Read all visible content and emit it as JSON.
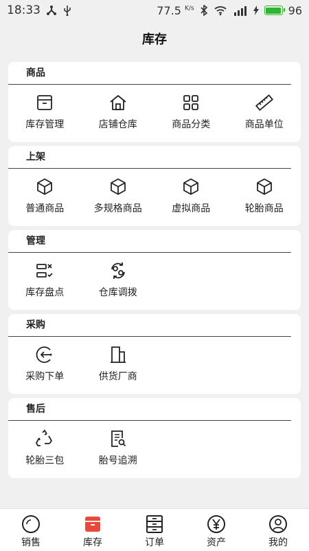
{
  "status_bar": {
    "time": "18:33",
    "speed_value": "77.5",
    "speed_unit": "K/s",
    "battery": "96",
    "colors": {
      "battery": "#2fb52f"
    }
  },
  "header": {
    "title": "库存"
  },
  "sections": [
    {
      "title": "商品",
      "items": [
        {
          "label": "库存管理",
          "icon": "box-icon"
        },
        {
          "label": "店铺仓库",
          "icon": "home-icon"
        },
        {
          "label": "商品分类",
          "icon": "grid-icon"
        },
        {
          "label": "商品单位",
          "icon": "ruler-icon"
        }
      ]
    },
    {
      "title": "上架",
      "items": [
        {
          "label": "普通商品",
          "icon": "cube-icon"
        },
        {
          "label": "多规格商品",
          "icon": "cube-icon"
        },
        {
          "label": "虚拟商品",
          "icon": "cube-icon"
        },
        {
          "label": "轮胎商品",
          "icon": "cube-icon"
        }
      ]
    },
    {
      "title": "管理",
      "items": [
        {
          "label": "库存盘点",
          "icon": "checklist-icon"
        },
        {
          "label": "仓库调拨",
          "icon": "transfer-icon"
        }
      ]
    },
    {
      "title": "采购",
      "items": [
        {
          "label": "采购下单",
          "icon": "arrow-circle-icon"
        },
        {
          "label": "供货厂商",
          "icon": "building-icon"
        }
      ]
    },
    {
      "title": "售后",
      "items": [
        {
          "label": "轮胎三包",
          "icon": "recycle-icon"
        },
        {
          "label": "胎号追溯",
          "icon": "document-search-icon"
        }
      ]
    }
  ],
  "bottom_nav": [
    {
      "label": "销售",
      "icon": "circle-icon",
      "active": false
    },
    {
      "label": "库存",
      "icon": "box-filled-icon",
      "active": true
    },
    {
      "label": "订单",
      "icon": "cabinet-icon",
      "active": false
    },
    {
      "label": "资产",
      "icon": "yen-icon",
      "active": false
    },
    {
      "label": "我的",
      "icon": "user-icon",
      "active": false
    }
  ],
  "colors": {
    "accent": "#e8493a",
    "text": "#222222",
    "background": "#f0f0f0"
  }
}
